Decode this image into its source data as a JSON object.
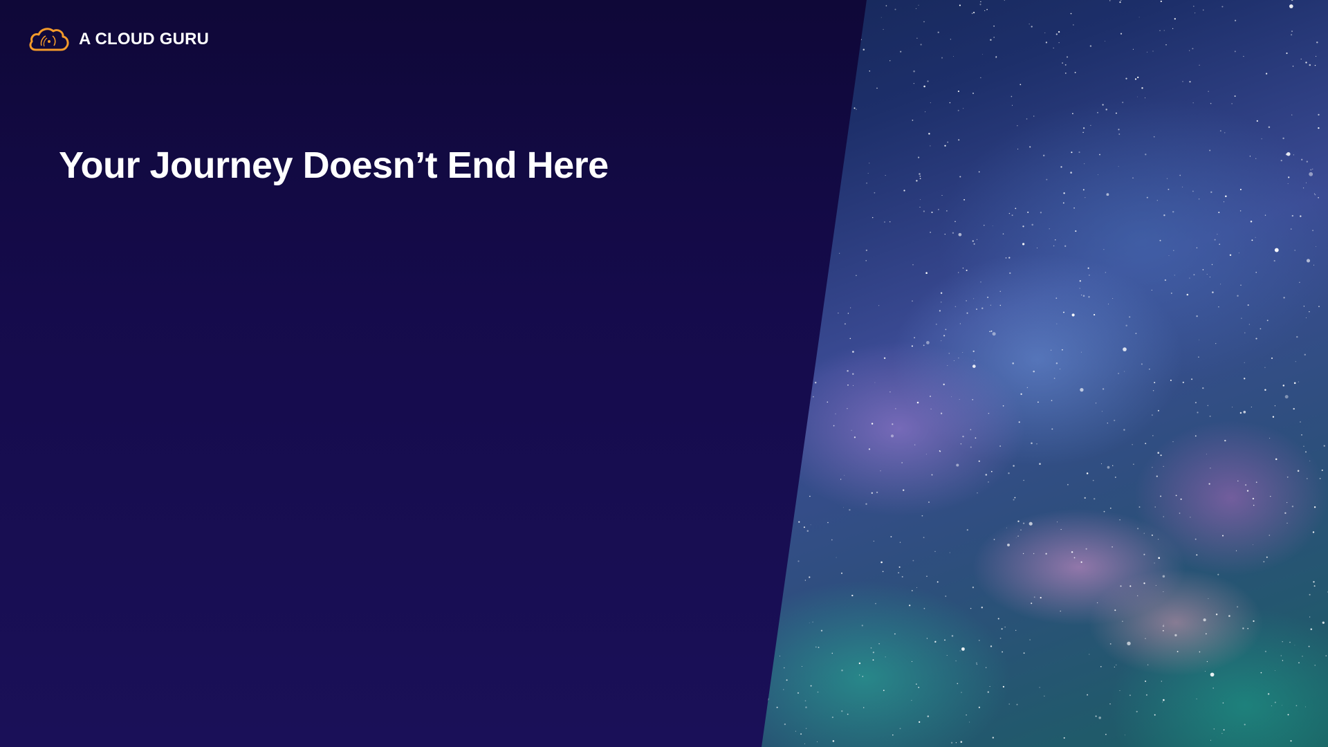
{
  "header": {
    "brand_name": "A CLOUD GURU",
    "logo_icon": "cloud-logo-icon"
  },
  "main": {
    "title": "Your Journey Doesn’t End Here"
  },
  "colors": {
    "background": "#150b4b",
    "logo_accent": "#f49a2a",
    "text": "#ffffff"
  }
}
